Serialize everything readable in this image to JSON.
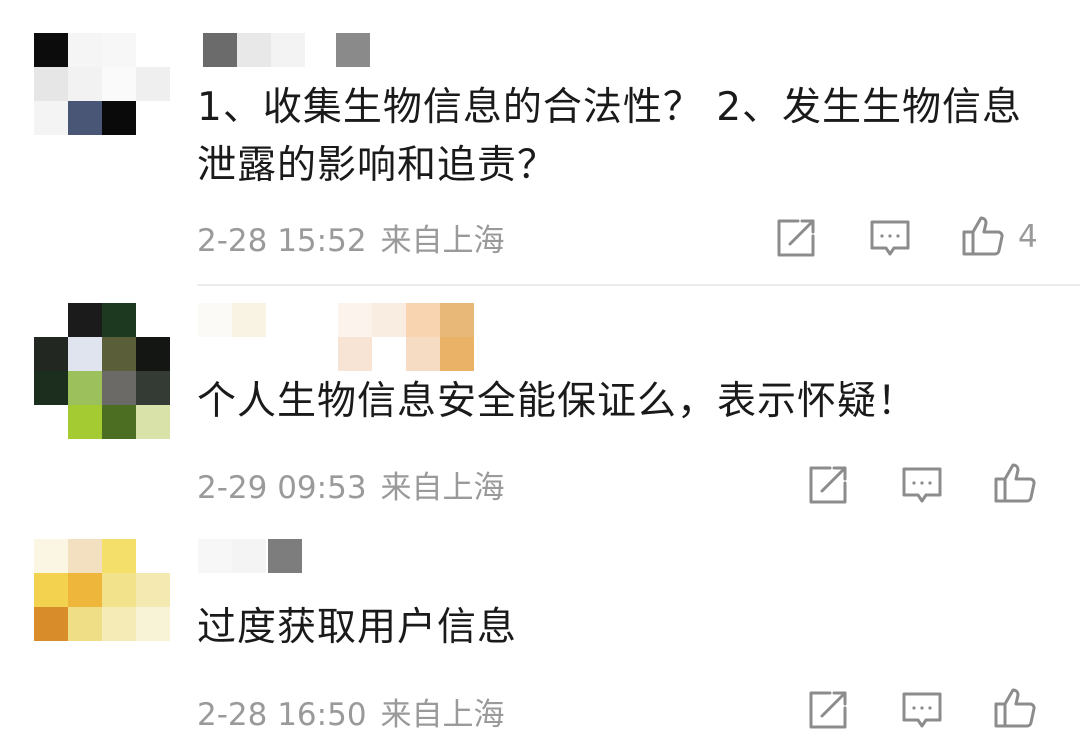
{
  "comments": [
    {
      "text": "1、收集生物信息的合法性？ 2、发生生物信息泄露的影响和追责？",
      "date": "2-28 15:52",
      "location": "来自上海",
      "like_count": "4"
    },
    {
      "text": "个人生物信息安全能保证么，表示怀疑！",
      "date": "2-29 09:53",
      "location": "来自上海",
      "like_count": ""
    },
    {
      "text": "过度获取用户信息",
      "date": "2-28 16:50",
      "location": "来自上海",
      "like_count": ""
    }
  ],
  "icons": {
    "share": "share-icon",
    "reply": "comment-icon",
    "like": "thumbs-up-icon"
  },
  "colors": {
    "text": "#1a1a1a",
    "meta": "#9a9a9a",
    "icon": "#8c8c8c",
    "divider": "#ececec"
  }
}
